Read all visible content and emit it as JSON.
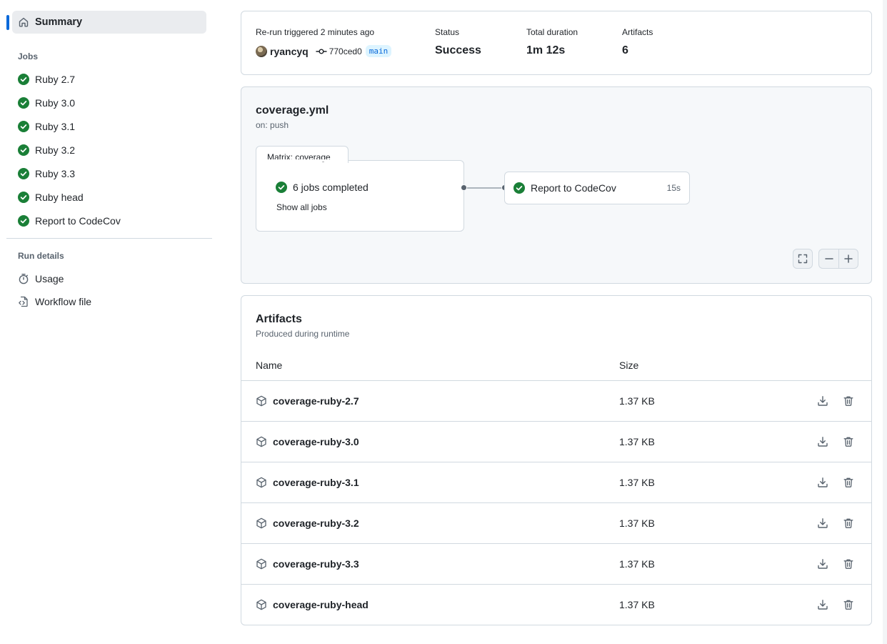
{
  "sidebar": {
    "summary_label": "Summary",
    "jobs_heading": "Jobs",
    "jobs": [
      {
        "label": "Ruby 2.7"
      },
      {
        "label": "Ruby 3.0"
      },
      {
        "label": "Ruby 3.1"
      },
      {
        "label": "Ruby 3.2"
      },
      {
        "label": "Ruby 3.3"
      },
      {
        "label": "Ruby head"
      },
      {
        "label": "Report to CodeCov"
      }
    ],
    "run_details_heading": "Run details",
    "usage_label": "Usage",
    "workflow_file_label": "Workflow file"
  },
  "summary": {
    "trigger_label": "Re-run triggered 2 minutes ago",
    "actor": "ryancyq",
    "commit": "770ced0",
    "branch": "main",
    "status_label": "Status",
    "status_value": "Success",
    "duration_label": "Total duration",
    "duration_value": "1m 12s",
    "artifacts_label": "Artifacts",
    "artifacts_value": "6"
  },
  "graph": {
    "workflow_name": "coverage.yml",
    "trigger": "on: push",
    "matrix_tab": "Matrix: coverage",
    "matrix_status": "6 jobs completed",
    "show_all": "Show all jobs",
    "downstream_job": "Report to CodeCov",
    "downstream_duration": "15s"
  },
  "artifacts": {
    "title": "Artifacts",
    "subtitle": "Produced during runtime",
    "col_name": "Name",
    "col_size": "Size",
    "rows": [
      {
        "name": "coverage-ruby-2.7",
        "size": "1.37 KB"
      },
      {
        "name": "coverage-ruby-3.0",
        "size": "1.37 KB"
      },
      {
        "name": "coverage-ruby-3.1",
        "size": "1.37 KB"
      },
      {
        "name": "coverage-ruby-3.2",
        "size": "1.37 KB"
      },
      {
        "name": "coverage-ruby-3.3",
        "size": "1.37 KB"
      },
      {
        "name": "coverage-ruby-head",
        "size": "1.37 KB"
      }
    ]
  },
  "colors": {
    "success": "#1a7f37",
    "accent": "#0969da",
    "border": "#d1d9e0"
  },
  "icons": [
    "home-icon",
    "check-circle-icon",
    "stopwatch-icon",
    "workflow-file-icon",
    "commit-icon",
    "package-icon",
    "download-icon",
    "trash-icon",
    "fullscreen-icon",
    "zoom-out-icon",
    "zoom-in-icon"
  ]
}
